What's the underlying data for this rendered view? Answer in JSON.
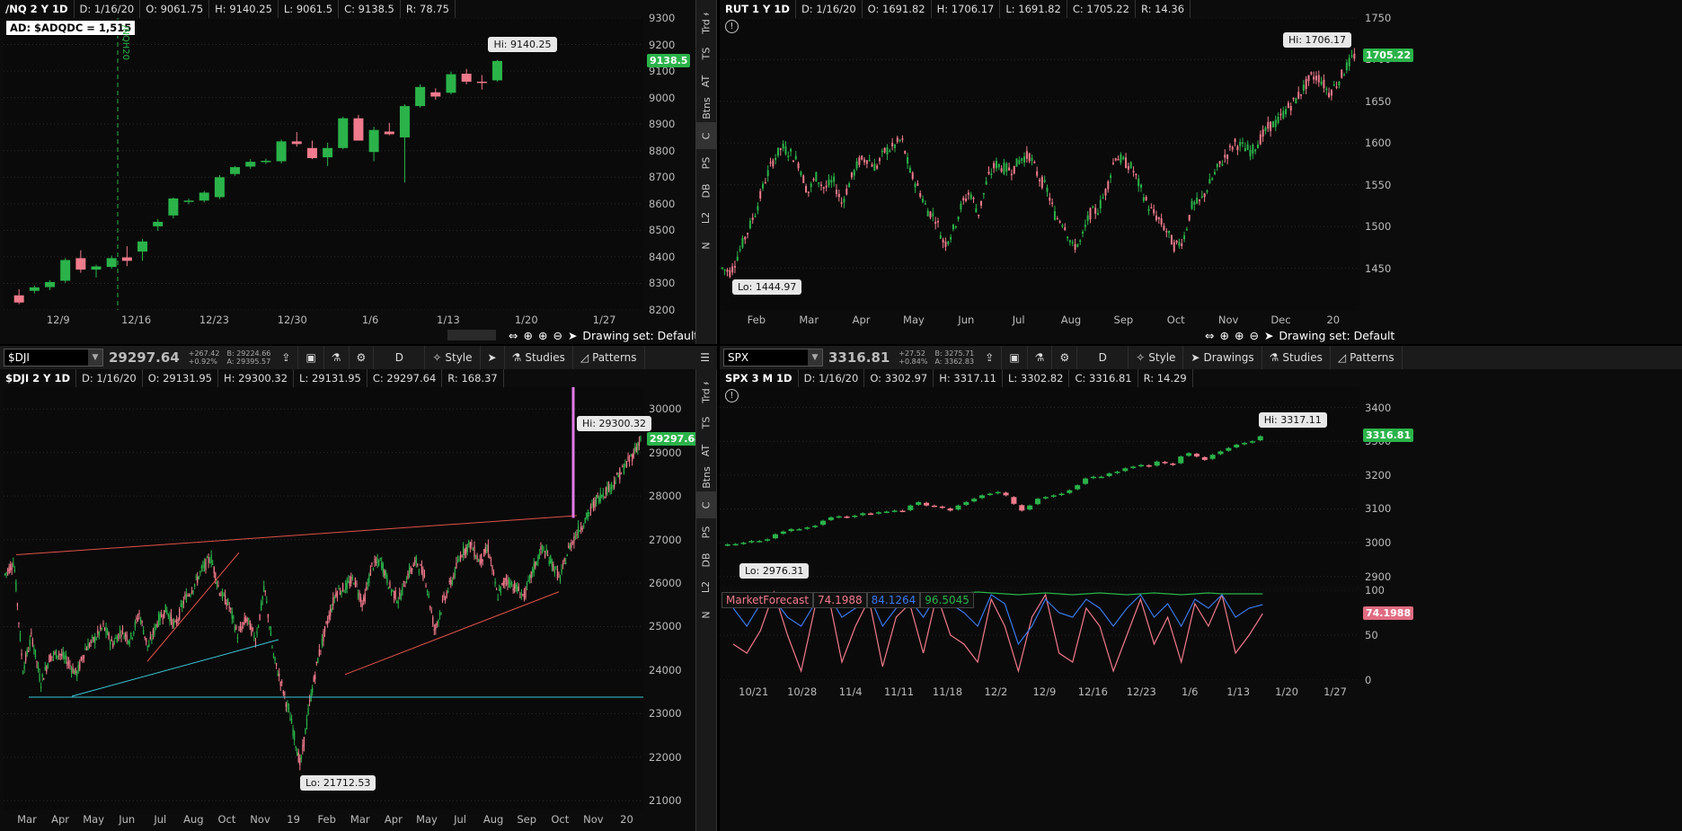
{
  "panels": {
    "nq": {
      "info": {
        "symbol": "/NQ 2 Y 1D",
        "date": "D: 1/16/20",
        "open": "O: 9061.75",
        "high": "H: 9140.25",
        "low": "L: 9061.5",
        "close": "C: 9138.5",
        "range": "R: 78.75"
      },
      "ad_label": "AD: $ADQDC = 1,515",
      "contract_marker": "/NQH20",
      "last_price": "9138.5",
      "hi_callout": "Hi: 9140.25",
      "drawing_set": "Drawing set: Default"
    },
    "rut": {
      "info": {
        "symbol": "RUT 1 Y 1D",
        "date": "D: 1/16/20",
        "open": "O: 1691.82",
        "high": "H: 1706.17",
        "low": "L: 1691.82",
        "close": "C: 1705.22",
        "range": "R: 14.36"
      },
      "last_price": "1705.22",
      "hi_callout": "Hi: 1706.17",
      "lo_callout": "Lo: 1444.97",
      "drawing_set": "Drawing set: Default"
    },
    "dji": {
      "toolbar": {
        "symbol": "$DJI",
        "price": "29297.64",
        "change": "+267.42",
        "change_pct": "+0.92%",
        "bid": "B: 29224.66",
        "ask": "A: 29395.57",
        "period": "D",
        "style": "Style",
        "studies": "Studies",
        "patterns": "Patterns"
      },
      "info": {
        "symbol": "$DJI 2 Y 1D",
        "date": "D: 1/16/20",
        "open": "O: 29131.95",
        "high": "H: 29300.32",
        "low": "L: 29131.95",
        "close": "C: 29297.64",
        "range": "R: 168.37"
      },
      "last_price": "29297.64",
      "hi_callout": "Hi: 29300.32",
      "lo_callout": "Lo: 21712.53"
    },
    "spx": {
      "toolbar": {
        "symbol": "SPX",
        "price": "3316.81",
        "change": "+27.52",
        "change_pct": "+0.84%",
        "bid": "B: 3275.71",
        "ask": "A: 3362.83",
        "period": "D",
        "style": "Style",
        "drawings": "Drawings",
        "studies": "Studies",
        "patterns": "Patterns"
      },
      "info": {
        "symbol": "SPX 3 M 1D",
        "date": "D: 1/16/20",
        "open": "O: 3302.97",
        "high": "H: 3317.11",
        "low": "L: 3302.82",
        "close": "C: 3316.81",
        "range": "R: 14.29"
      },
      "last_price": "3316.81",
      "hi_callout": "Hi: 3317.11",
      "lo_callout": "Lo: 2976.31",
      "mf": {
        "name": "MarketForecast",
        "v1": "74.1988",
        "v2": "84.1264",
        "v3": "96.5045",
        "last": "74.1988"
      }
    }
  },
  "side_tabs": [
    "Trd",
    "TS",
    "AT",
    "Btns",
    "C",
    "PS",
    "DB",
    "L2",
    "N"
  ],
  "colors": {
    "up": "#2bb34a",
    "down": "#f07b8c",
    "bg": "#0a0a0a"
  },
  "chart_data": [
    {
      "type": "candlestick",
      "title": "/NQ 2 Y 1D",
      "ylim": [
        8200,
        9300
      ],
      "y_ticks": [
        "9300",
        "9200",
        "9100",
        "9000",
        "8900",
        "8800",
        "8700",
        "8600",
        "8500",
        "8400",
        "8300",
        "8200"
      ],
      "x_ticks": [
        "12/9",
        "12/16",
        "12/23",
        "12/30",
        "1/6",
        "1/13",
        "1/20",
        "1/27"
      ],
      "candles": [
        [
          8255,
          8278,
          8222,
          8228
        ],
        [
          8272,
          8292,
          8262,
          8285
        ],
        [
          8286,
          8312,
          8275,
          8305
        ],
        [
          8310,
          8395,
          8302,
          8388
        ],
        [
          8395,
          8425,
          8340,
          8352
        ],
        [
          8352,
          8370,
          8322,
          8364
        ],
        [
          8362,
          8405,
          8355,
          8395
        ],
        [
          8398,
          8440,
          8365,
          8385
        ],
        [
          8420,
          8468,
          8385,
          8458
        ],
        [
          8515,
          8542,
          8498,
          8532
        ],
        [
          8556,
          8624,
          8545,
          8620
        ],
        [
          8608,
          8620,
          8598,
          8612
        ],
        [
          8612,
          8648,
          8605,
          8642
        ],
        [
          8625,
          8708,
          8618,
          8700
        ],
        [
          8712,
          8742,
          8705,
          8738
        ],
        [
          8740,
          8768,
          8732,
          8758
        ],
        [
          8758,
          8770,
          8750,
          8762
        ],
        [
          8760,
          8842,
          8752,
          8835
        ],
        [
          8835,
          8870,
          8815,
          8825
        ],
        [
          8810,
          8838,
          8768,
          8772
        ],
        [
          8775,
          8830,
          8742,
          8810
        ],
        [
          8810,
          8928,
          8805,
          8922
        ],
        [
          8922,
          8935,
          8845,
          8838
        ],
        [
          8795,
          8890,
          8760,
          8878
        ],
        [
          8872,
          8905,
          8858,
          8862
        ],
        [
          8850,
          8975,
          8680,
          8968
        ],
        [
          8968,
          9050,
          8962,
          9040
        ],
        [
          9020,
          9035,
          8992,
          9004
        ],
        [
          9018,
          9098,
          9012,
          9088
        ],
        [
          9090,
          9108,
          9050,
          9060
        ],
        [
          9060,
          9085,
          9030,
          9055
        ],
        [
          9065,
          9142,
          9060,
          9138
        ]
      ]
    },
    {
      "type": "candlestick",
      "title": "RUT 1 Y 1D",
      "ylim": [
        1400,
        1750
      ],
      "y_ticks": [
        "1750",
        "1700",
        "1650",
        "1600",
        "1550",
        "1500",
        "1450"
      ],
      "x_ticks": [
        "Feb",
        "Mar",
        "Apr",
        "May",
        "Jun",
        "Jul",
        "Aug",
        "Sep",
        "Oct",
        "Nov",
        "Dec",
        "20"
      ],
      "path_closes": [
        1450,
        1445,
        1470,
        1495,
        1520,
        1555,
        1580,
        1595,
        1588,
        1575,
        1540,
        1560,
        1545,
        1555,
        1528,
        1555,
        1578,
        1582,
        1570,
        1590,
        1595,
        1605,
        1565,
        1545,
        1520,
        1510,
        1478,
        1495,
        1525,
        1542,
        1515,
        1555,
        1575,
        1570,
        1568,
        1582,
        1585,
        1560,
        1545,
        1512,
        1505,
        1475,
        1482,
        1515,
        1520,
        1545,
        1585,
        1578,
        1570,
        1545,
        1522,
        1510,
        1495,
        1475,
        1485,
        1525,
        1530,
        1550,
        1570,
        1585,
        1600,
        1595,
        1590,
        1605,
        1620,
        1625,
        1640,
        1650,
        1665,
        1680,
        1678,
        1660,
        1672,
        1690,
        1705
      ]
    },
    {
      "type": "candlestick",
      "title": "$DJI 2 Y 1D",
      "ylim": [
        20800,
        30500
      ],
      "y_ticks": [
        "30000",
        "29000",
        "28000",
        "27000",
        "26000",
        "25000",
        "24000",
        "23000",
        "22000",
        "21000"
      ],
      "x_ticks": [
        "Mar",
        "Apr",
        "May",
        "Jun",
        "Jul",
        "Aug",
        "Oct",
        "Nov",
        "19",
        "Feb",
        "Mar",
        "Apr",
        "May",
        "Jul",
        "Aug",
        "Sep",
        "Oct",
        "Nov",
        "20"
      ],
      "path_closes": [
        26200,
        26500,
        24000,
        24800,
        23700,
        24300,
        24400,
        24200,
        23900,
        24500,
        24700,
        25000,
        24600,
        24900,
        24700,
        25300,
        24500,
        25100,
        25400,
        25000,
        25600,
        25900,
        26300,
        26600,
        25800,
        25500,
        24800,
        25200,
        24700,
        25900,
        24300,
        23600,
        22800,
        21800,
        23200,
        24300,
        25100,
        25800,
        25900,
        26100,
        25500,
        26400,
        26500,
        25900,
        25600,
        26200,
        26500,
        26100,
        24900,
        25600,
        26100,
        26700,
        26900,
        26500,
        26800,
        25700,
        26100,
        25900,
        25700,
        26300,
        26800,
        26500,
        26100,
        26800,
        27200,
        27500,
        27900,
        28100,
        28300,
        28600,
        28900,
        29300
      ]
    },
    {
      "type": "candlestick",
      "title": "SPX 3 M 1D",
      "ylim": [
        2870,
        3460
      ],
      "y_ticks": [
        "3400",
        "3300",
        "3200",
        "3100",
        "3000",
        "2900"
      ],
      "x_ticks": [
        "10/21",
        "10/28",
        "11/4",
        "11/11",
        "11/18",
        "12/2",
        "12/9",
        "12/16",
        "12/23",
        "1/6",
        "1/13",
        "1/20",
        "1/27"
      ],
      "closes": [
        2995,
        2996,
        3000,
        3005,
        3005,
        3010,
        3025,
        3033,
        3040,
        3040,
        3045,
        3050,
        3065,
        3075,
        3078,
        3075,
        3080,
        3087,
        3085,
        3090,
        3092,
        3095,
        3093,
        3110,
        3120,
        3110,
        3108,
        3103,
        3095,
        3110,
        3120,
        3130,
        3140,
        3145,
        3150,
        3140,
        3115,
        3095,
        3110,
        3130,
        3135,
        3140,
        3145,
        3155,
        3170,
        3190,
        3195,
        3195,
        3205,
        3210,
        3220,
        3225,
        3230,
        3225,
        3240,
        3235,
        3230,
        3255,
        3265,
        3255,
        3245,
        3260,
        3270,
        3280,
        3290,
        3295,
        3300,
        3315
      ]
    },
    {
      "type": "line",
      "title": "MarketForecast",
      "ylim": [
        0,
        100
      ],
      "y_ticks": [
        "100",
        "50",
        "0"
      ],
      "series": [
        {
          "name": "74.1988",
          "color": "#f07b8c",
          "values": [
            40,
            30,
            55,
            98,
            50,
            10,
            80,
            95,
            20,
            60,
            90,
            15,
            70,
            85,
            30,
            95,
            50,
            40,
            20,
            90,
            60,
            10,
            70,
            95,
            30,
            20,
            80,
            60,
            10,
            50,
            90,
            40,
            70,
            20,
            85,
            60,
            95,
            30,
            50,
            74
          ]
        },
        {
          "name": "84.1264",
          "color": "#3a78e8",
          "values": [
            80,
            60,
            85,
            90,
            70,
            60,
            85,
            95,
            70,
            80,
            95,
            60,
            80,
            90,
            70,
            95,
            85,
            75,
            60,
            95,
            85,
            40,
            60,
            90,
            75,
            70,
            90,
            80,
            60,
            80,
            95,
            70,
            85,
            60,
            90,
            80,
            95,
            70,
            80,
            84
          ]
        },
        {
          "name": "96.5045",
          "color": "#2bb34a",
          "values": [
            85,
            90,
            92,
            95,
            96,
            95,
            94,
            95,
            96,
            97,
            96,
            95,
            96,
            97,
            96,
            95,
            96,
            97,
            98,
            97,
            96,
            95,
            96,
            97,
            96,
            95,
            96,
            97,
            96,
            95,
            96,
            97,
            96,
            95,
            96,
            97,
            96,
            96,
            96,
            96
          ]
        }
      ]
    }
  ]
}
